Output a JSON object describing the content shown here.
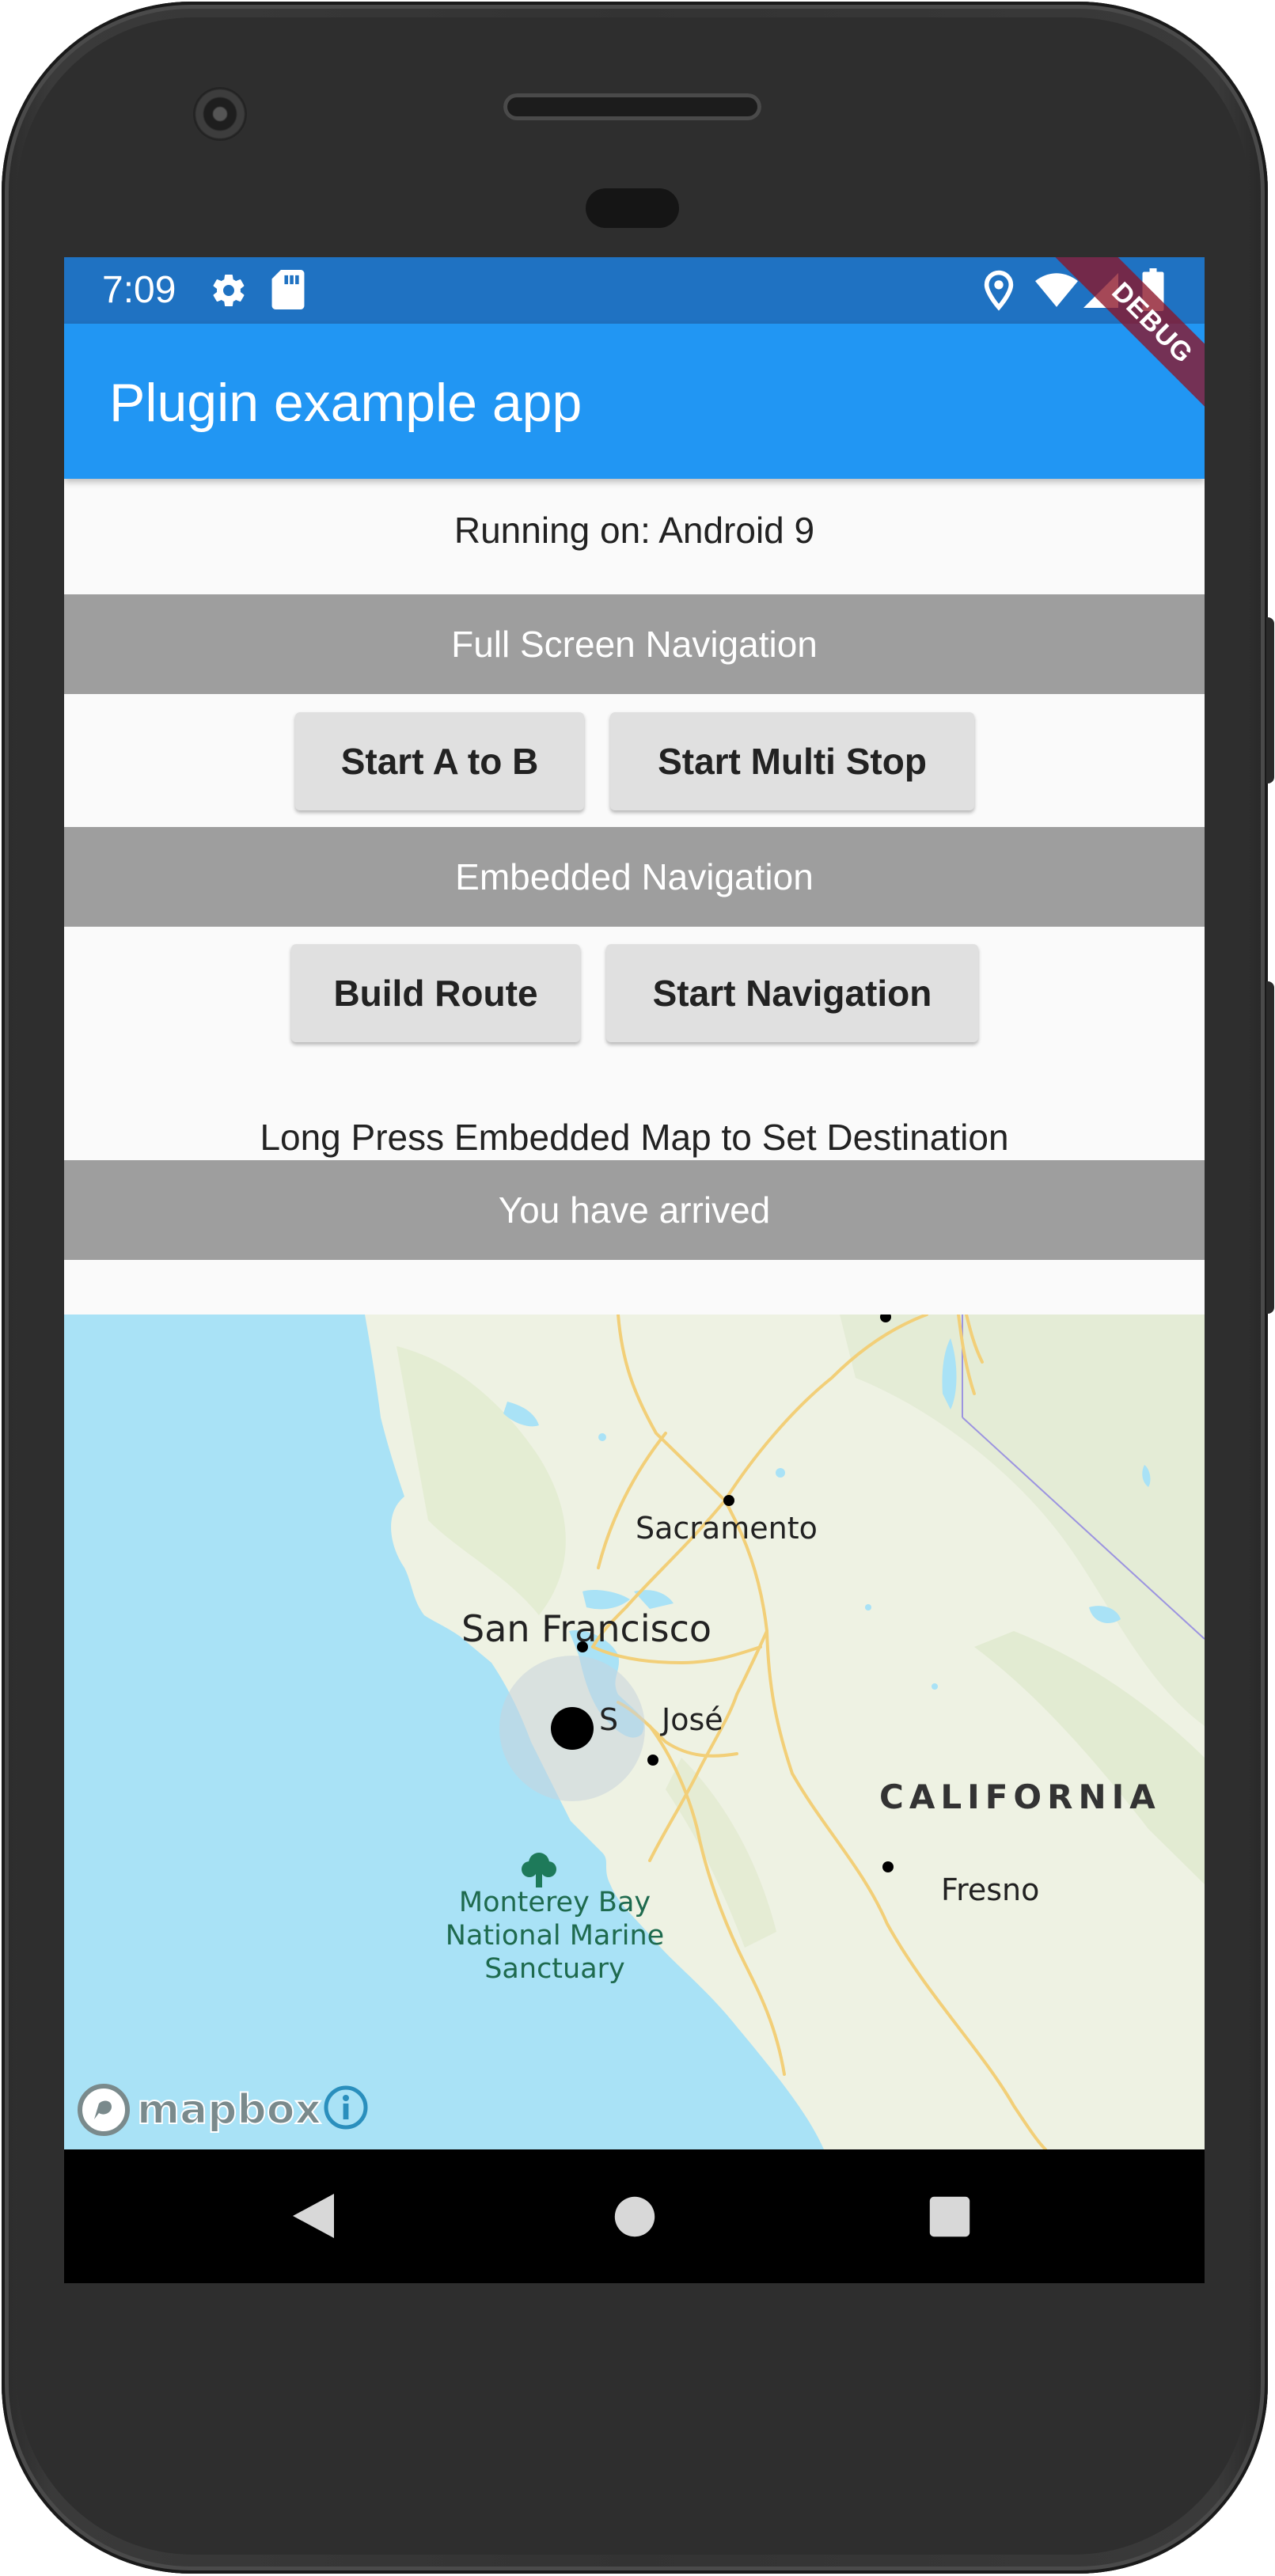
{
  "status_bar": {
    "time": "7:09",
    "left_icons": [
      "gear-icon",
      "sd-card-icon"
    ],
    "right_icons": [
      "location-pin-icon",
      "wifi-icon",
      "signal-icon",
      "battery-icon"
    ],
    "color": "#1f72c2"
  },
  "debug_banner": "DEBUG",
  "app_bar": {
    "title": "Plugin example app",
    "color": "#2196f3"
  },
  "running_on": "Running on: Android 9",
  "sections": {
    "full_screen": {
      "label": "Full Screen Navigation",
      "buttons": [
        "Start A to B",
        "Start Multi Stop"
      ]
    },
    "embedded": {
      "label": "Embedded Navigation",
      "buttons": [
        "Build Route",
        "Start Navigation"
      ]
    }
  },
  "instruction": "Long Press Embedded Map to Set Destination",
  "status_message": "You have arrived",
  "map": {
    "labels": {
      "sacramento": "Sacramento",
      "san_francisco": "San Francisco",
      "san_jose_prefix": "S",
      "san_jose_suffix": "José",
      "california": "CALIFORNIA",
      "fresno": "Fresno",
      "monterey_line1": "Monterey Bay",
      "monterey_line2": "National Marine",
      "monterey_line3": "Sanctuary"
    },
    "attribution": "mapbox",
    "land_color": "#eef2e3",
    "water_color": "#a9e2f6"
  },
  "nav_bar": {
    "buttons": [
      "back-icon",
      "home-icon",
      "recents-icon"
    ]
  }
}
